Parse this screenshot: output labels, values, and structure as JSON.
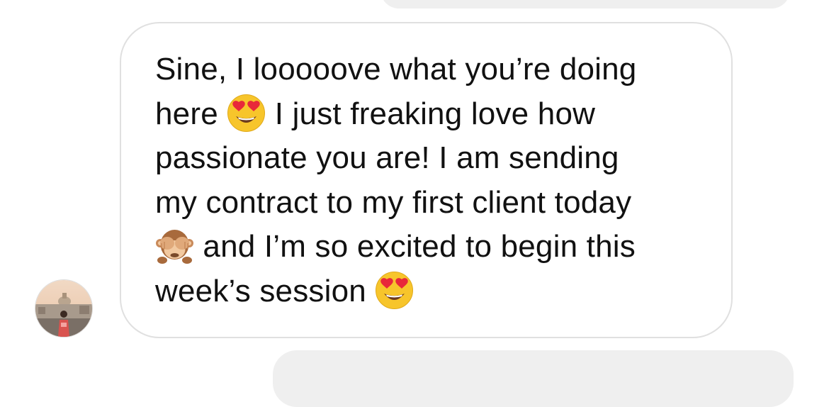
{
  "message": {
    "lines": [
      {
        "text": "Sine, I looooove what you’re doing"
      },
      {
        "text": "here ",
        "emoji": "heart-eyes-emoji",
        "text_after": " I just freaking love how"
      },
      {
        "text": "passionate you are! I am sending"
      },
      {
        "text": "my contract to my first client today"
      },
      {
        "emoji": "see-no-evil-monkey-emoji",
        "text_after": " and I’m so excited to begin this"
      },
      {
        "text": "week’s session ",
        "emoji": "heart-eyes-emoji"
      }
    ]
  },
  "avatar": {
    "icon": "profile-photo"
  },
  "colors": {
    "bubble_border": "#e0e0e0",
    "neighbor_bubble": "#efefef",
    "text": "#111111"
  }
}
